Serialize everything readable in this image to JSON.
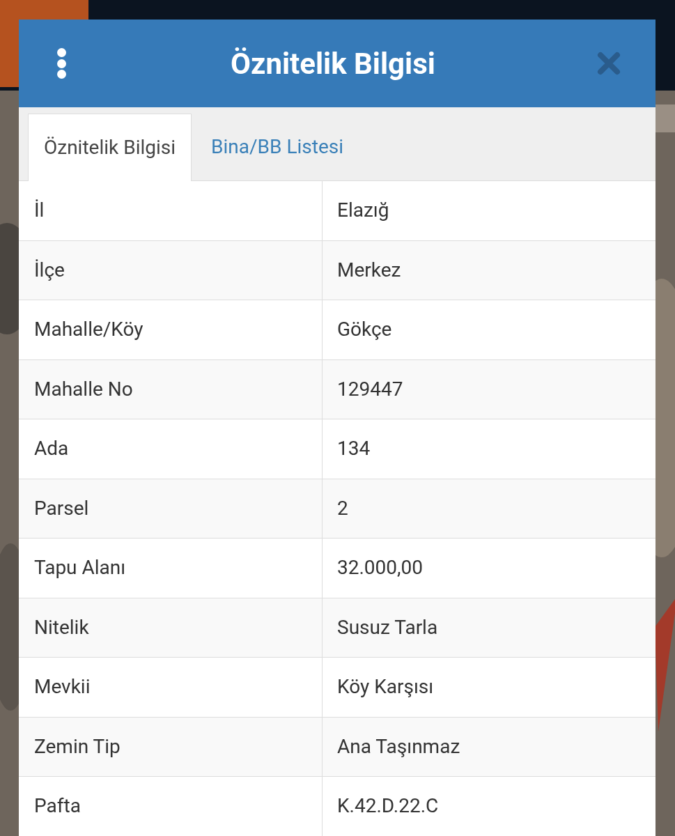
{
  "dialog": {
    "title": "Öznitelik Bilgisi"
  },
  "tabs": [
    {
      "label": "Öznitelik Bilgisi",
      "selected": true
    },
    {
      "label": "Bina/BB Listesi",
      "selected": false
    }
  ],
  "rows": [
    {
      "label": "İl",
      "value": "Elazığ"
    },
    {
      "label": "İlçe",
      "value": "Merkez"
    },
    {
      "label": "Mahalle/Köy",
      "value": "Gökçe"
    },
    {
      "label": "Mahalle No",
      "value": "129447"
    },
    {
      "label": "Ada",
      "value": "134"
    },
    {
      "label": "Parsel",
      "value": "2"
    },
    {
      "label": "Tapu Alanı",
      "value": "32.000,00"
    },
    {
      "label": "Nitelik",
      "value": "Susuz Tarla"
    },
    {
      "label": "Mevkii",
      "value": "Köy Karşısı"
    },
    {
      "label": "Zemin Tip",
      "value": "Ana Taşınmaz"
    },
    {
      "label": "Pafta",
      "value": "K.42.D.22.C"
    }
  ]
}
